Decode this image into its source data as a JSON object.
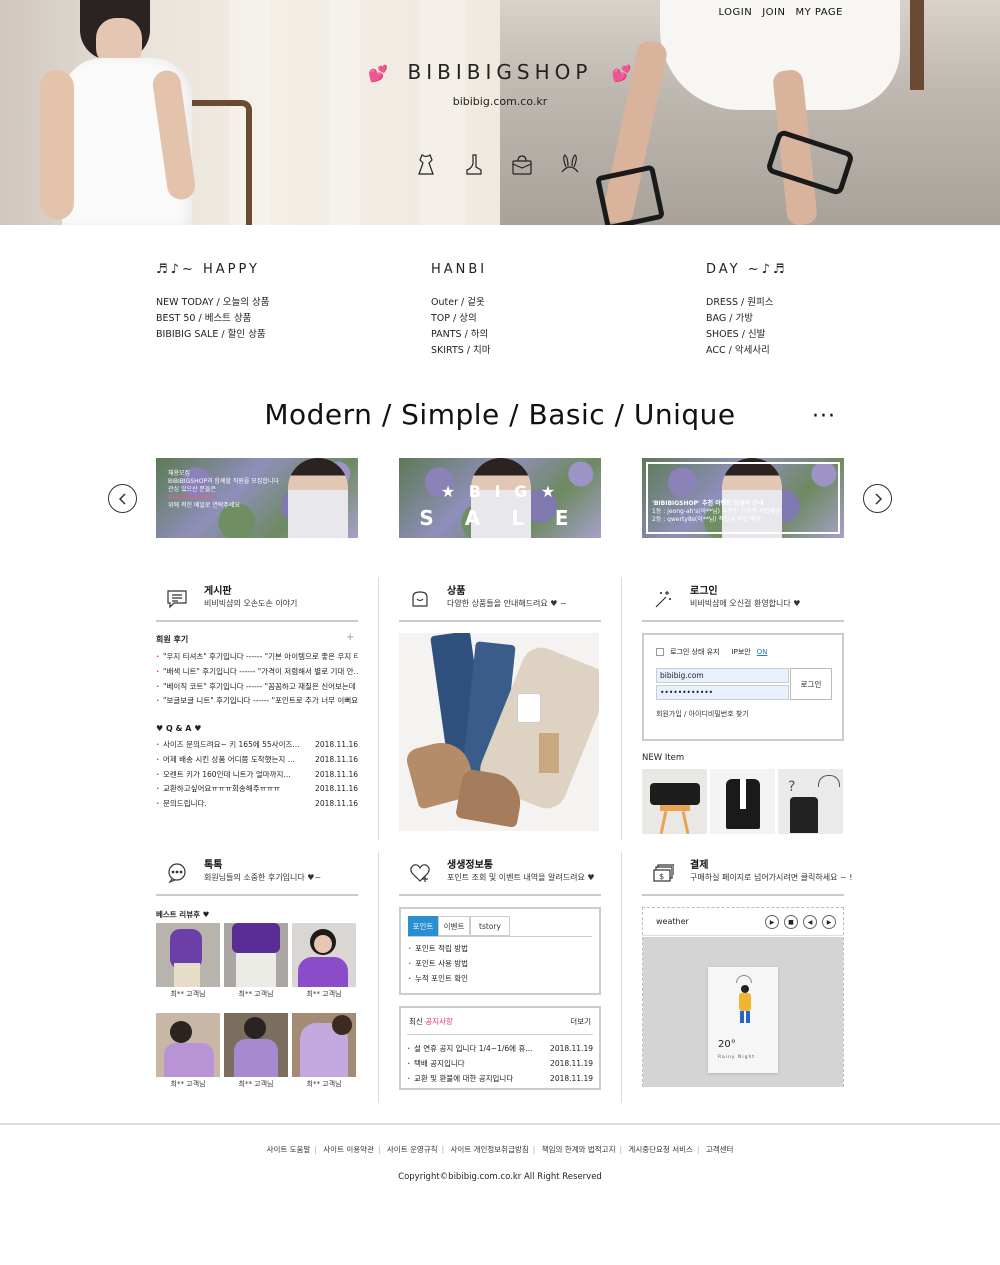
{
  "top_nav": {
    "login": "LOGIN",
    "join": "JOIN",
    "mypage": "MY PAGE"
  },
  "hero": {
    "title": "BIBIBIGSHOP",
    "heart": "💕",
    "url": "bibibig.com.co.kr",
    "icons": [
      "dress-icon",
      "heel-shoe-icon",
      "bag-icon",
      "bunny-ear-headband-icon"
    ]
  },
  "categories": [
    {
      "title": "♬♪~ HAPPY",
      "items": [
        "NEW TODAY / 오늘의 상품",
        "BEST 50 / 베스트 상품",
        "BIBIBIG SALE / 할인 상품"
      ]
    },
    {
      "title": "HANBI",
      "items": [
        "Outer / 겉옷",
        "TOP / 상의",
        "PANTS / 하의",
        "SKIRTS / 치마"
      ]
    },
    {
      "title": "DAY ~♪♬",
      "items": [
        "DRESS / 원피스",
        "BAG / 가방",
        "SHOES / 신발",
        "ACC / 악세사리"
      ]
    }
  ],
  "tagline": "Modern / Simple / Basic / Unique",
  "more": "···",
  "banners": {
    "b1": {
      "lines": [
        "채용모집",
        "BIBIBIGSHOP과 함께할 직원을 모집합니다",
        "관심 있으신 분들은",
        "010-0000-0000",
        "위에 적힌 메일로 연락주세요"
      ]
    },
    "b2": {
      "big1": "★ B I G ★",
      "big2": "S A L E"
    },
    "b3": {
      "lines": [
        "'BIBIBIGSHOP' 추천 이벤트 당첨자 안내",
        "1등 : jeong-ah's(아**님) 추천인 상품권 적립예정",
        "2등 : qwerty8s(이**님) 적립금 적립 예정"
      ]
    }
  },
  "board": {
    "title": "게시판",
    "subtitle": "비비빅샵의 오손도손 이야기",
    "review_title": "회원 후기",
    "plus": "+",
    "reviews": [
      "\"우지 티셔츠\" 후기입니다 ------ \"기본 아이템으로 좋은 우지 티셔츠...",
      "\"배색 니트\" 후기입니다 ------ \"가격이 저렴해서 별로 기대 안...",
      "\"베이직 코트\" 후기입니다 ------ \"꼼꼼하고 재질은 신어보는데 대칭...",
      "\"보글보글 니트\" 후기입니다 ------ \"포인트로 추가 너무 이뻐요 ㅠ..."
    ],
    "qa_title": "♥ Q & A ♥",
    "qa": [
      {
        "text": "사이즈 문의드려요~ 키 165에 55사이즈...",
        "date": "2018.11.16"
      },
      {
        "text": "어제 배송 시킨 상품 어디쯤 도착했는지 ...",
        "date": "2018.11.16"
      },
      {
        "text": "오렌트 키가 160인데 니트가 얼마까지...",
        "date": "2018.11.16"
      },
      {
        "text": "교환하고싶어요ㅠㅠㅠ회송해주ㅠㅠㅠ",
        "date": "2018.11.16"
      },
      {
        "text": "문의드립니다.",
        "date": "2018.11.16"
      }
    ]
  },
  "product": {
    "title": "상품",
    "subtitle": "다양한 상품들을 안내해드려요 ♥ ~"
  },
  "login": {
    "title": "로그인",
    "subtitle": "비비빅샵에 오신걸 환영합니다 ♥",
    "keep_login": "로그인 상태 유지",
    "ip_security": "IP보안",
    "ip_on": "ON",
    "id_value": "bibibig.com",
    "pw_value": "••••••••••••",
    "login_button": "로그인",
    "links": "회원가입 / 아이디비밀번호 찾기",
    "new_item_label": "NEW Item"
  },
  "talk": {
    "title": "톡톡",
    "subtitle": "회원님들의 소중한 후기입니다 ♥~",
    "best_label": "베스트 리뷰후 ♥",
    "reviewers": [
      "최** 고객님",
      "최** 고객님",
      "최** 고객님",
      "최** 고객님",
      "최** 고객님",
      "최** 고객님"
    ]
  },
  "living": {
    "title": "생생정보통",
    "subtitle": "포인트 조회 및 이벤트 내역을 알려드려요 ♥",
    "tabs": [
      "포인트",
      "이벤트",
      "tstory"
    ],
    "points": [
      "포인트 적립 방법",
      "포인트 사용 방법",
      "누적 포인트 확인"
    ],
    "notice_prefix": "최신 ",
    "notice_title": "공지사항",
    "notice_more": "더보기",
    "notices": [
      {
        "text": "설 연휴 공지 입니다 1/4~1/6에 휴...",
        "date": "2018.11.19"
      },
      {
        "text": "택배 공지입니다",
        "date": "2018.11.19"
      },
      {
        "text": "교환 및 환불에 대한 공지입니다",
        "date": "2018.11.19"
      }
    ]
  },
  "payment": {
    "title": "결제",
    "subtitle": "구매하실 페이지로 넘어가시려면 클릭하세요 ~ !",
    "weather_label": "weather",
    "temp": "20°",
    "weather_desc": "Rainy Night"
  },
  "footer": {
    "links": [
      "사이트 도움말",
      "사이트 이용약관",
      "사이트 운영규칙",
      "사이트 개인정보취급방침",
      "책임의 한계와 법적고지",
      "게시중단요청 서비스",
      "고객센터"
    ],
    "copyright": "Copyright©bibibig.com.co.kr All Right Reserved"
  }
}
